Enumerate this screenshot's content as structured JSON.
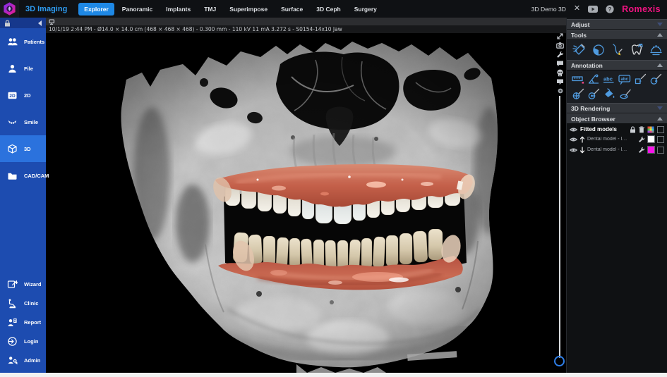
{
  "topbar": {
    "title": "3D Imaging",
    "tabs": [
      {
        "label": "Explorer",
        "active": true
      },
      {
        "label": "Panoramic"
      },
      {
        "label": "Implants"
      },
      {
        "label": "TMJ"
      },
      {
        "label": "Superimpose"
      },
      {
        "label": "Surface"
      },
      {
        "label": "3D Ceph"
      },
      {
        "label": "Surgery"
      }
    ],
    "patient_label": "3D Demo 3D",
    "close_label": "✕",
    "help_label": "?",
    "brand": "Romexis"
  },
  "sidebar": {
    "items": [
      {
        "label": "Patients",
        "icon": "patients-icon"
      },
      {
        "label": "File",
        "icon": "person-icon"
      },
      {
        "label": "2D",
        "icon": "2d-badge-icon"
      },
      {
        "label": "Smile",
        "icon": "smile-teeth-icon"
      },
      {
        "label": "3D",
        "icon": "3d-cube-icon",
        "active": true
      },
      {
        "label": "CAD/CAM",
        "icon": "folder-icon"
      }
    ],
    "bottom_items": [
      {
        "label": "Wizard",
        "icon": "wizard-icon"
      },
      {
        "label": "Clinic",
        "icon": "clinic-chair-icon"
      },
      {
        "label": "Report",
        "icon": "report-icon"
      },
      {
        "label": "Login",
        "icon": "login-icon"
      },
      {
        "label": "Admin",
        "icon": "admin-key-icon"
      }
    ]
  },
  "viewport": {
    "meta_text": "10/1/19 2:44 PM - Ø14.0 × 14.0 cm (468 × 468 × 468) - 0.300 mm - 110 kV 11 mA 3.272 s - S0154-14x10 Jaw",
    "side_tools": [
      "fullscreen-icon",
      "camera-icon",
      "wrench-icon",
      "comment-icon",
      "skull-icon",
      "chat-icon",
      "knob-icon"
    ]
  },
  "right_panel": {
    "adjust_label": "Adjust",
    "tools_label": "Tools",
    "annotation_label": "Annotation",
    "rendering_label": "3D Rendering",
    "object_browser_label": "Object Browser",
    "annotation_sample": "abc",
    "tools_icons": [
      "airbrush-tool-icon",
      "sculpt-sphere-tool-icon",
      "nerve-tracing-tool-icon",
      "tooth-segmentation-tool-icon",
      "implant-planning-tool-icon"
    ],
    "annotation_icons": [
      "ruler-icon",
      "angle-icon",
      "text-annotation-icon",
      "label-annotation-icon",
      "rectangle-draw-icon",
      "circle-draw-icon",
      "crosshair-draw-icon",
      "point-draw-icon",
      "fill-icon",
      "brush-icon"
    ],
    "object_browser": {
      "group_label": "Fitted models",
      "items": [
        {
          "label": "Dental model - Imported ...",
          "direction": "up",
          "swatch": "#ffffff"
        },
        {
          "label": "Dental model - Imported ...",
          "direction": "down",
          "swatch": "#f714e9"
        }
      ]
    }
  },
  "colors": {
    "accent_blue": "#2e9bf0",
    "active_tab_blue": "#1e88e5",
    "sidebar_blue": "#1d4cb0",
    "selected_blue": "#2b72dd",
    "brand_magenta": "#ef1380",
    "panel_icon_blue": "#4f9be0",
    "swatch_white": "#ffffff",
    "swatch_magenta": "#f714e9"
  }
}
